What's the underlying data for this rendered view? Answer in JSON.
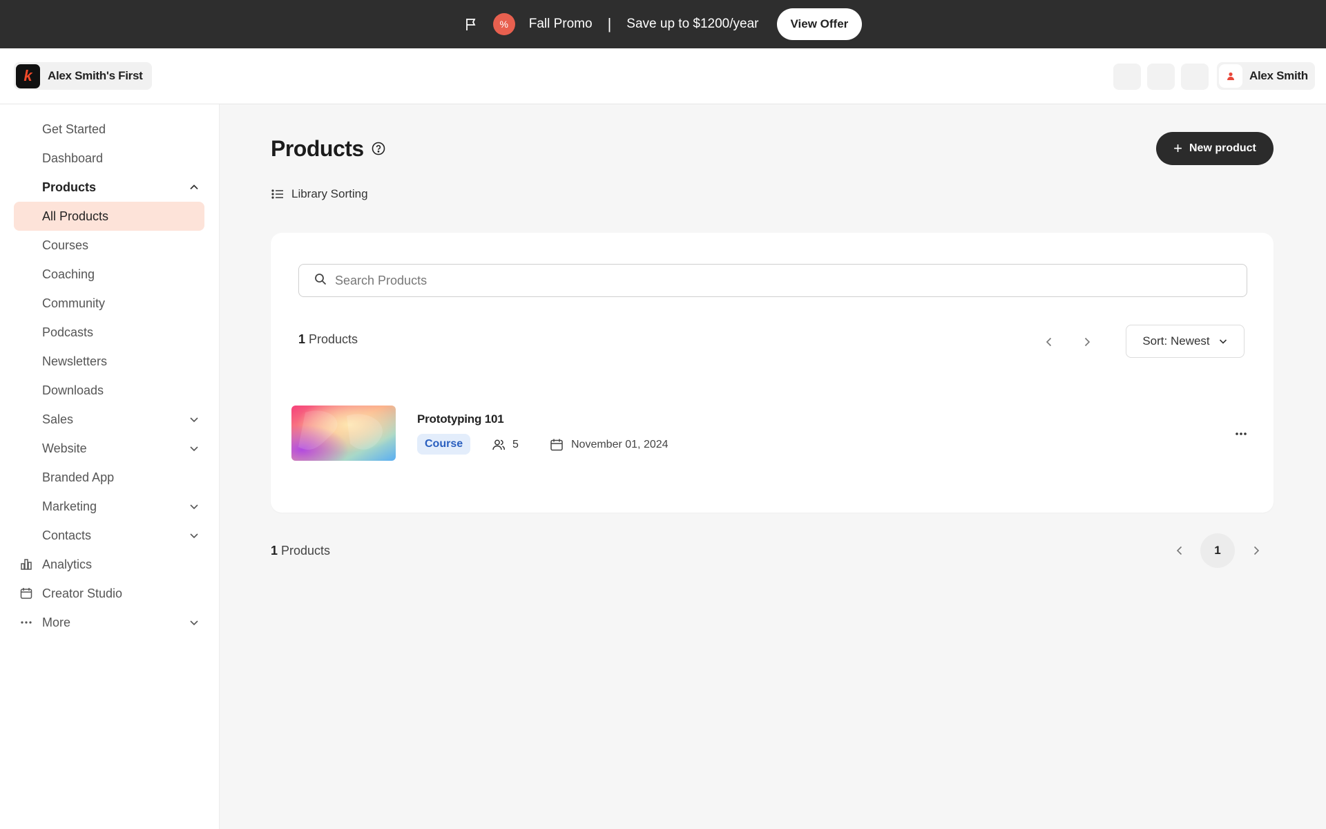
{
  "promo": {
    "title": "Fall Promo",
    "separator": "|",
    "message": "Save up to $1200/year",
    "button": "View Offer",
    "percent_glyph": "%",
    "icons": [
      "flag-icon",
      "percent-icon"
    ]
  },
  "header": {
    "brand_name": "Alex Smith's First",
    "logo_glyph": "k",
    "user_name": "Alex Smith"
  },
  "sidebar": {
    "items": [
      {
        "label": "Get Started"
      },
      {
        "label": "Dashboard"
      },
      {
        "label": "Products",
        "expanded": true
      },
      {
        "label": "All Products",
        "active": true
      },
      {
        "label": "Courses"
      },
      {
        "label": "Coaching"
      },
      {
        "label": "Community"
      },
      {
        "label": "Podcasts"
      },
      {
        "label": "Newsletters"
      },
      {
        "label": "Downloads"
      },
      {
        "label": "Sales",
        "chevron": "down"
      },
      {
        "label": "Website",
        "chevron": "down"
      },
      {
        "label": "Branded App"
      },
      {
        "label": "Marketing",
        "chevron": "down"
      },
      {
        "label": "Contacts",
        "chevron": "down"
      },
      {
        "label": "Analytics",
        "icon": "bar-chart-icon"
      },
      {
        "label": "Creator Studio",
        "icon": "calendar-icon"
      },
      {
        "label": "More",
        "icon": "ellipsis-icon",
        "chevron": "down"
      }
    ]
  },
  "main": {
    "title": "Products",
    "new_button": "New product",
    "library_sorting": "Library Sorting",
    "search_placeholder": "Search Products",
    "count_number": "1",
    "count_label": " Products",
    "sort_label": "Sort: Newest",
    "product": {
      "title": "Prototyping 101",
      "type": "Course",
      "members": "5",
      "date": "November 01, 2024"
    },
    "footer_count_number": "1",
    "footer_count_label": " Products",
    "current_page": "1"
  },
  "colors": {
    "promo_bg": "#2e2e2e",
    "accent": "#e8604f",
    "active_nav_bg": "#fde3d9",
    "badge_bg": "#e3edfb",
    "badge_text": "#2a5fbf",
    "primary_button": "#2b2b2b"
  }
}
